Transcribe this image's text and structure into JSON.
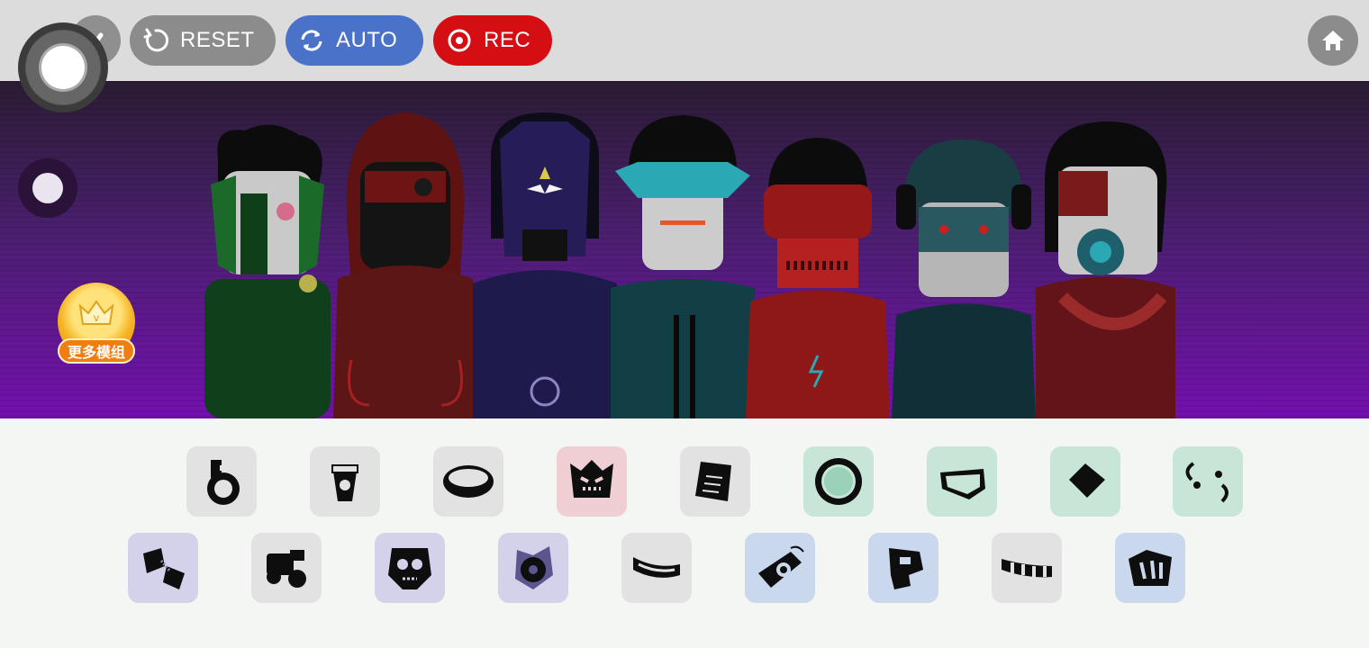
{
  "top_bar": {
    "reset_label": "RESET",
    "auto_label": "AUTO",
    "rec_label": "REC"
  },
  "side": {
    "more_mods_label": "更多模组"
  },
  "stage": {
    "characters": [
      {
        "name": "green-scaled",
        "color": "#1f5a2a"
      },
      {
        "name": "red-hood",
        "color": "#7a1717"
      },
      {
        "name": "purple-masked",
        "color": "#2a1f5a"
      },
      {
        "name": "teal-visor",
        "color": "#174f55"
      },
      {
        "name": "red-helmet",
        "color": "#8a1a1a"
      },
      {
        "name": "teal-headphones",
        "color": "#1c4048"
      },
      {
        "name": "red-goggles",
        "color": "#7a1c20"
      }
    ]
  },
  "sound_tray": {
    "row1": [
      {
        "icon": "loop-beat-icon",
        "bg": "#e2e2e2"
      },
      {
        "icon": "cup-icon",
        "bg": "#e2e2e2"
      },
      {
        "icon": "bowl-icon",
        "bg": "#e2e2e2"
      },
      {
        "icon": "spiky-face-icon",
        "bg": "#f0cfd4"
      },
      {
        "icon": "plate-icon",
        "bg": "#e2e2e2"
      },
      {
        "icon": "gear-sun-icon",
        "bg": "#c8e6d8"
      },
      {
        "icon": "visor-icon",
        "bg": "#c8e6d8"
      },
      {
        "icon": "diamond-icon",
        "bg": "#c8e6d8"
      },
      {
        "icon": "swirl-icon",
        "bg": "#c8e6d8"
      }
    ],
    "row2": [
      {
        "icon": "capsule-icon",
        "bg": "#d4d2ea"
      },
      {
        "icon": "gadget-icon",
        "bg": "#e2e2e2"
      },
      {
        "icon": "skull-icon",
        "bg": "#d4d2ea"
      },
      {
        "icon": "rose-icon",
        "bg": "#d4d2ea"
      },
      {
        "icon": "band-icon",
        "bg": "#e2e2e2"
      },
      {
        "icon": "eye-gadget-icon",
        "bg": "#c9d8ec"
      },
      {
        "icon": "tower-icon",
        "bg": "#c9d8ec"
      },
      {
        "icon": "striped-band-icon",
        "bg": "#e2e2e2"
      },
      {
        "icon": "shield-icon",
        "bg": "#c9d8ec"
      }
    ]
  }
}
